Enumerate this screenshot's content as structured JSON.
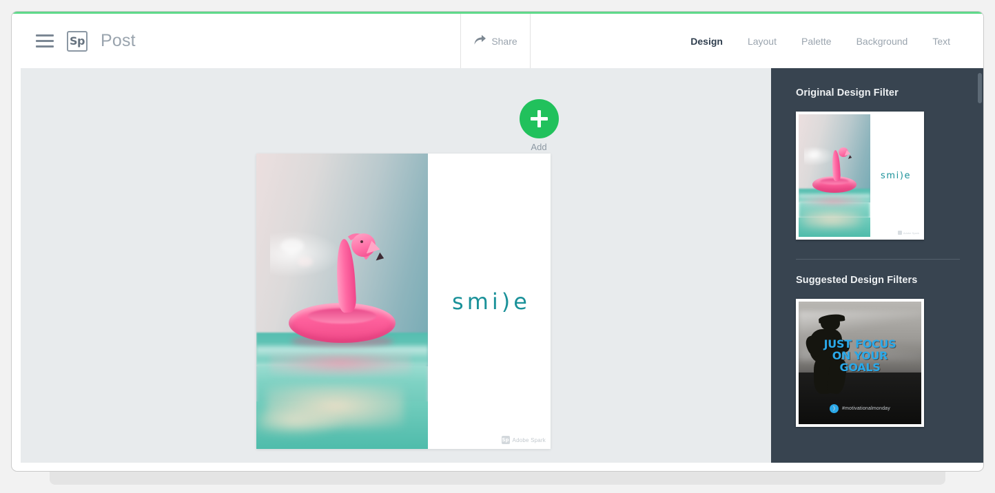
{
  "header": {
    "menu_icon": "hamburger-menu-icon",
    "app_logo_text": "Sp",
    "doc_title": "Post",
    "share_label": "Share",
    "share_icon": "share-arrow-icon",
    "nav_items": [
      {
        "label": "Design",
        "active": true
      },
      {
        "label": "Layout",
        "active": false
      },
      {
        "label": "Palette",
        "active": false
      },
      {
        "label": "Background",
        "active": false
      },
      {
        "label": "Text",
        "active": false
      }
    ]
  },
  "canvas": {
    "add_button_label": "Add",
    "add_button_icon": "plus-icon",
    "artboard": {
      "headline": "smi)e",
      "watermark_logo": "Sp",
      "watermark_text": "Adobe Spark"
    }
  },
  "right_panel": {
    "original_section_title": "Original Design Filter",
    "suggested_section_title": "Suggested Design Filters",
    "original_thumb": {
      "headline": "smi)e",
      "watermark_text": "Adobe Spark"
    },
    "suggested_thumb": {
      "line1": "JUST FOCUS",
      "line2": "ON YOUR",
      "line3": "GOALS",
      "hashtag": "#motivationalmonday",
      "social_icon": "twitter-icon"
    }
  },
  "colors": {
    "accent_green": "#5fd98a",
    "add_button_green": "#21c15c",
    "panel_dark": "#384450",
    "headline_teal": "#1a9199",
    "suggested_blue": "#2aa8e8",
    "nav_active": "#2f3e4e",
    "nav_inactive": "#9aa4ae",
    "canvas_bg": "#e8ebed"
  }
}
